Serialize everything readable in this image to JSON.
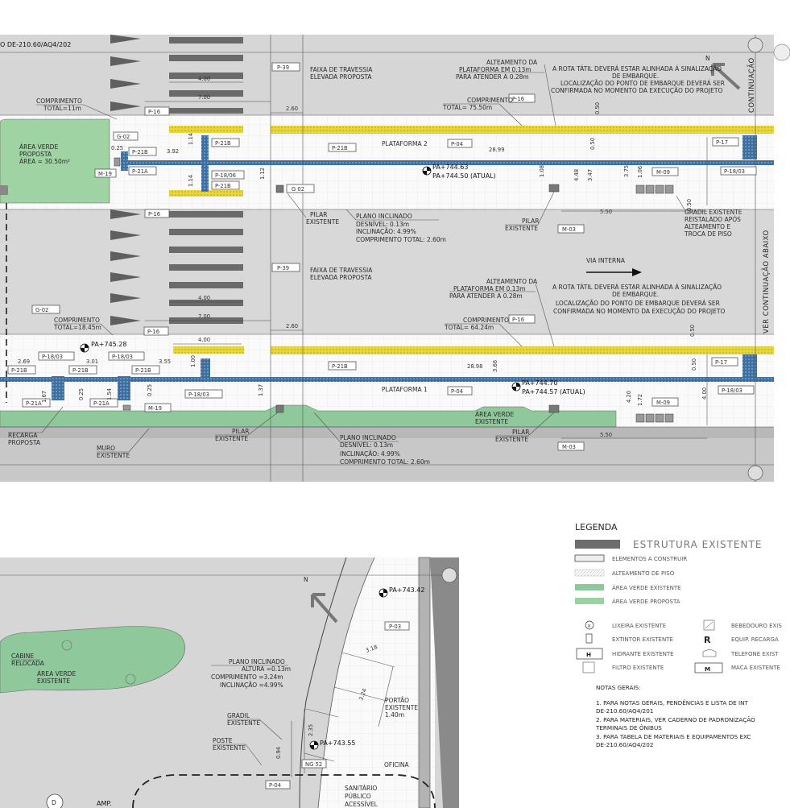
{
  "colors": {
    "road_gray": "#d6d6d6",
    "platform_white": "#f7f7f7",
    "tactile_yellow": "#e7d43a",
    "tactile_blue": "#2b5d8f",
    "green_existing": "#8fc69a",
    "green_proposed": "#9ad39f",
    "structure_dark": "#6d6d6d"
  },
  "top": {
    "ref_drawing": "O DE-210.60/AQ4/202",
    "continuacao": "CONTINUAÇÃO",
    "ver_continuacao_abaixo": "VER CONTINUAÇÃO ABAIXO",
    "north": "N",
    "via_interna": "VIA INTERNA",
    "faixa_1": "FAIXA DE TRAVESSIA",
    "faixa_2": "ELEVADA PROPOSTA",
    "comprimento_a1": "COMPRIMENTO",
    "comprimento_a2": "TOTAL=11m",
    "area_verde_1": "ÁREA VERDE",
    "area_verde_2": "PROPOSTA",
    "area_verde_3": "ÁREA = 30.50m²",
    "plataforma_2": "PLATAFORMA 2",
    "plataforma_1": "PLATAFORMA 1",
    "pa_p2_proj": "PA+744.63",
    "pa_p2_atual": "PA+744.50  (ATUAL)",
    "pa_p1_proj": "PA+744.70",
    "pa_p1_atual": "PA+744.57  (ATUAL)",
    "pa_left": "PA+745.28",
    "alteamento_1": "ALTEAMENTO DA",
    "alteamento_2": "PLATAFORMA EM 0.13m",
    "alteamento_3": "PARA ATENDER A 0.28m",
    "rota_1": "A ROTA TÁTIL DEVERÁ ESTAR ALINHADA Á SINALIZAÇÃO",
    "rota_2": "DE EMBARQUE.",
    "rota_3": "LOCALIZAÇÃO DO PONTO DE EMBARQUE DEVERÁ SER",
    "rota_4": "CONFIRMADA NO MOMENTO DA EXECUÇÃO DO PROJETO",
    "comp_p2_1": "COMPRIMENTO",
    "comp_p2_2": "TOTAL= 75.50m",
    "comp_p1_1": "COMPRIMENTO",
    "comp_p1_2": "TOTAL= 64.24m",
    "comp_left_1": "COMPRIMENTO",
    "comp_left_2": "TOTAL=18.45m",
    "pilar_1": "PILAR",
    "pilar_2": "EXISTENTE",
    "plano_1": "PLANO INCLINADO",
    "plano_2": "DESNÍVEL: 0.13m",
    "plano_3": "INCLINAÇÃO: 4.99%",
    "plano_4": "COMPRIMENTO TOTAL: 2.60m",
    "gradil_1": "GRADIL EXISTENTE",
    "gradil_2": "REISTALADO APÓS",
    "gradil_3": "ALTEAMENTO E",
    "gradil_4": "TROCA DE PISO",
    "area_verde_exist_1": "ÁREA VERDE",
    "area_verde_exist_2": "EXISTENTE",
    "recarga_1": "RECARGA",
    "recarga_2": "PROPOSTA",
    "muro_1": "MURO",
    "muro_2": "EXISTENTE",
    "tags": [
      "P-39",
      "P-16",
      "G-02",
      "P-21B",
      "P-21A",
      "M-19",
      "P-18/06",
      "G 02",
      "P-04",
      "P-17",
      "P-18/03",
      "M-09",
      "M-03",
      "P-18/03",
      "P-21B"
    ],
    "dims": [
      "4.00",
      "7.00",
      "2.60",
      "0.25",
      "3.92",
      "1.14",
      "1.14",
      "1.12",
      "28.99",
      "0.50",
      "0.50",
      "1.08",
      "4.48",
      "3.47",
      "3.75",
      "1.06",
      "5.50",
      "0.50",
      "4.00",
      "7.00",
      "2.60",
      "4.00",
      "3.55",
      "2.69",
      "3.01",
      "1.00",
      "28.98",
      "3.66",
      "1.37",
      "0.25",
      "0.25",
      "1.54",
      "1.67",
      "4.20",
      "1.72",
      "4.00",
      "0.50",
      "5.50"
    ]
  },
  "bottom": {
    "north": "N",
    "pa_1": "PA+743.42",
    "pa_2": "PA+743.55",
    "p03": "P-03",
    "p04": "P-04",
    "ng": "NG 52",
    "cabine_1": "CABINE",
    "cabine_2": "RELOCADA",
    "area_1": "ÁREA VERDE",
    "area_2": "EXISTENTE",
    "plano_1": "PLANO INCLINADO",
    "plano_2": "ALTURA =0.13m",
    "plano_3": "COMPRIMENTO =3.24m",
    "plano_4": "INCLINAÇÃO =4.99%",
    "gradil_1": "GRADIL",
    "gradil_2": "EXISTENTE",
    "poste_1": "POSTE",
    "poste_2": "EXISTENTE",
    "portao_1": "PORTÃO",
    "portao_2": "EXISTENTE",
    "portao_3": "1.40m",
    "oficina": "OFICINA",
    "sanitario_1": "SANITÁRIO",
    "sanitario_2": "PÚBLICO",
    "sanitario_3": "ACESSÍVEL",
    "d": "D",
    "amp": "AMP.",
    "dim_1": "3.18",
    "dim_2": "3.24",
    "dim_3": "2.35",
    "dim_4": "0.94",
    "dim_5": "1.40"
  },
  "legend": {
    "title": "LEGENDA",
    "estrutura": "ESTRUTURA EXISTENTE",
    "elementos": "ELEMENTOS A CONSTRUIR",
    "alteamento": "ALTEAMENTO DE PISO",
    "area_existente": "ÁREA VERDE EXISTENTE",
    "area_proposta": "ÁREA VERDE PROPOSTA",
    "lixeira": "LIXEIRA EXISTENTE",
    "extintor": "EXTINTOR EXISTENTE",
    "hidrante": "HIDRANTE EXISTENTE",
    "filtro": "FILTRO EXISTENTE",
    "bebedouro": "BEBEDOURO EXIS",
    "recarga": "EQUIP. RECARGA",
    "telefone": "TELEFONE EXIST",
    "maca": "MACA EXISTENTE",
    "sym_x": "x",
    "sym_r": "R",
    "sym_h": "H",
    "sym_m": "M",
    "notas_title": "NOTAS GERAIS:",
    "nota1a": "1.    PARA NOTAS GERAIS, PENDÊNCIAS E LISTA DE INT",
    "nota1b": "DE-210.60/AQ4/201",
    "nota2a": "2.    PARA MATERIAIS, VER CADERNO DE PADRONIZAÇÃO",
    "nota2b": "TERMINAIS DE ÔNIBUS",
    "nota3a": "3.    PARA TABELA DE MATERIAIS E EQUIPAMENTOS EXC",
    "nota3b": "DE-210.60/AQ4/202"
  }
}
